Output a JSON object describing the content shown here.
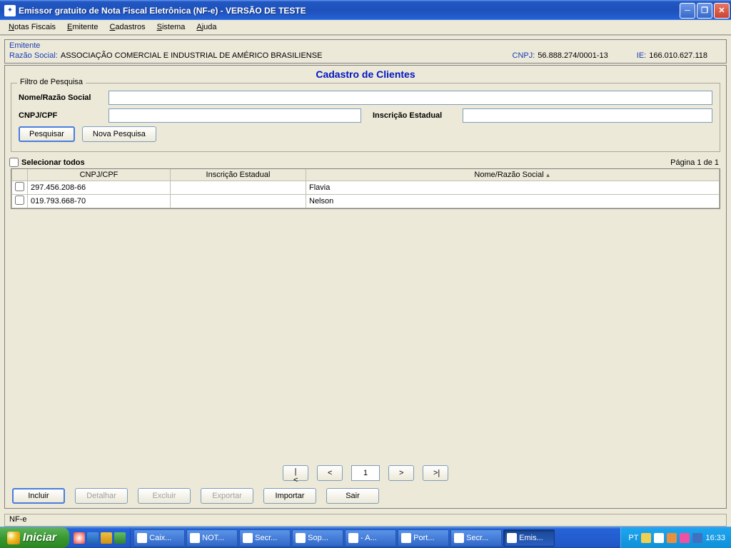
{
  "window": {
    "title": "Emissor gratuito de Nota Fiscal Eletrônica (NF-e) - VERSÃO DE TESTE"
  },
  "menu": {
    "items": [
      "Notas Fiscais",
      "Emitente",
      "Cadastros",
      "Sistema",
      "Ajuda"
    ]
  },
  "emitente": {
    "title": "Emitente",
    "razao_label": "Razão Social:",
    "razao_value": "ASSOCIAÇÃO COMERCIAL E INDUSTRIAL DE AMÉRICO BRASILIENSE",
    "cnpj_label": "CNPJ:",
    "cnpj_value": "56.888.274/0001-13",
    "ie_label": "IE:",
    "ie_value": "166.010.627.118"
  },
  "page": {
    "title": "Cadastro de Clientes"
  },
  "filter": {
    "legend": "Filtro de Pesquisa",
    "nome_label": "Nome/Razão Social",
    "nome_value": "",
    "cnpj_label": "CNPJ/CPF",
    "cnpj_value": "",
    "ie_label": "Inscrição Estadual",
    "ie_value": "",
    "btn_pesquisar": "Pesquisar",
    "btn_nova": "Nova Pesquisa"
  },
  "list": {
    "select_all": "Selecionar todos",
    "page_text": "Página 1 de 1",
    "headers": {
      "cnpj": "CNPJ/CPF",
      "ie": "Inscrição Estadual",
      "nome": "Nome/Razão Social"
    },
    "rows": [
      {
        "cnpj": "297.456.208-66",
        "ie": "",
        "nome": "Flavia"
      },
      {
        "cnpj": "019.793.668-70",
        "ie": "",
        "nome": "Nelson"
      }
    ]
  },
  "pager": {
    "first": "|<",
    "prev": "<",
    "page": "1",
    "next": ">",
    "last": ">|"
  },
  "buttons": {
    "incluir": "Incluir",
    "detalhar": "Detalhar",
    "excluir": "Excluir",
    "exportar": "Exportar",
    "importar": "Importar",
    "sair": "Sair"
  },
  "status": {
    "text": "NF-e"
  },
  "taskbar": {
    "start": "Iniciar",
    "tasks": [
      {
        "label": "Caix..."
      },
      {
        "label": "NOT..."
      },
      {
        "label": "Secr..."
      },
      {
        "label": "Sop..."
      },
      {
        "label": "- A..."
      },
      {
        "label": "Port..."
      },
      {
        "label": "Secr..."
      },
      {
        "label": "Emis...",
        "active": true
      }
    ],
    "lang": "PT",
    "clock": "16:33"
  }
}
